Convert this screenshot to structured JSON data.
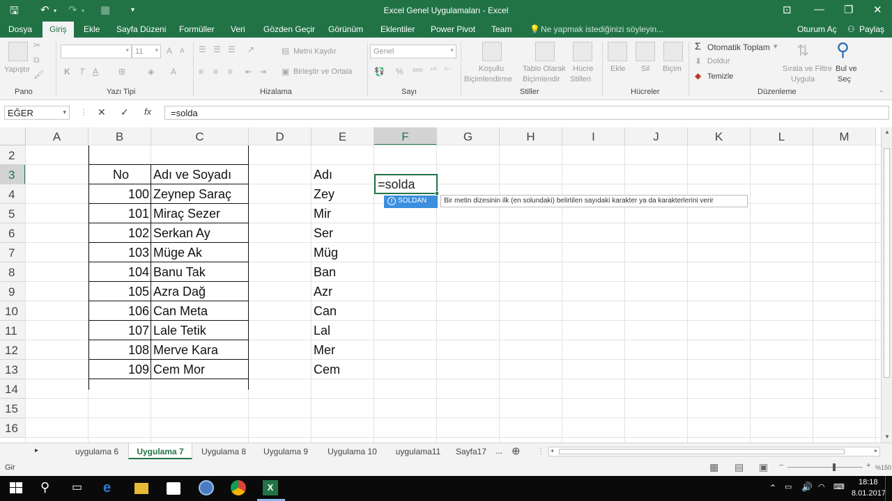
{
  "window": {
    "title": "Excel Genel Uygulamaları - Excel"
  },
  "menu": {
    "file": "Dosya",
    "home": "Giriş",
    "insert": "Ekle",
    "layout": "Sayfa Düzeni",
    "formulas": "Formüller",
    "data": "Veri",
    "review": "Gözden Geçir",
    "view": "Görünüm",
    "addins": "Eklentiler",
    "powerpivot": "Power Pivot",
    "team": "Team",
    "tellme": "Ne yapmak istediğinizi söyleyin...",
    "signin": "Oturum Aç",
    "share": "Paylaş"
  },
  "ribbon": {
    "paste": "Yapıştır",
    "clipboard": "Pano",
    "font_size": "11",
    "font_group": "Yazı Tipi",
    "bold": "K",
    "italic": "T",
    "underline": "A",
    "wrap_text": "Metni Kaydır",
    "merge": "Birleştir ve Ortala",
    "alignment": "Hizalama",
    "number_format": "Genel",
    "percent": "%",
    "number": "Sayı",
    "cond_fmt_1": "Koşullu",
    "cond_fmt_2": "Biçimlendirme",
    "table_fmt_1": "Tablo Olarak",
    "table_fmt_2": "Biçimlendir",
    "cell_styles_1": "Hücre",
    "cell_styles_2": "Stilleri",
    "styles": "Stiller",
    "insert": "Ekle",
    "delete": "Sil",
    "format": "Biçim",
    "cells": "Hücreler",
    "autosum": "Otomatik Toplam",
    "fill": "Doldur",
    "clear": "Temizle",
    "sort_1": "Sırala ve Filtre",
    "sort_2": "Uygula",
    "find_1": "Bul ve",
    "find_2": "Seç",
    "editing": "Düzenleme"
  },
  "formula_bar": {
    "name_box": "EĞER",
    "cancel": "✕",
    "enter": "✓",
    "fx": "fx",
    "formula": "=solda"
  },
  "columns": [
    "A",
    "B",
    "C",
    "D",
    "E",
    "F",
    "G",
    "H",
    "I",
    "J",
    "K",
    "L",
    "M"
  ],
  "rows": [
    "2",
    "3",
    "4",
    "5",
    "6",
    "7",
    "8",
    "9",
    "10",
    "11",
    "12",
    "13",
    "14",
    "15",
    "16"
  ],
  "table": {
    "header_no": "No",
    "header_name": "Adı ve Soyadı",
    "header_first": "Adı",
    "records": [
      {
        "no": "100",
        "name": "Zeynep Saraç",
        "first": "Zey"
      },
      {
        "no": "101",
        "name": "Miraç Sezer",
        "first": "Mir"
      },
      {
        "no": "102",
        "name": "Serkan Ay",
        "first": "Ser"
      },
      {
        "no": "103",
        "name": "Müge Ak",
        "first": "Müg"
      },
      {
        "no": "104",
        "name": "Banu Tak",
        "first": "Ban"
      },
      {
        "no": "105",
        "name": "Azra Dağ",
        "first": "Azr"
      },
      {
        "no": "106",
        "name": "Can Meta",
        "first": "Can"
      },
      {
        "no": "107",
        "name": "Lale Tetik",
        "first": "Lal"
      },
      {
        "no": "108",
        "name": "Merve Kara",
        "first": "Mer"
      },
      {
        "no": "109",
        "name": "Cem Mor",
        "first": "Cem"
      }
    ]
  },
  "active_cell": {
    "value": "=solda"
  },
  "autocomplete": {
    "item": "SOLDAN",
    "tooltip": "Bir metin dizesinin ilk (en solundaki) belirtilen sayıdaki karakter ya da karakterlerini verir"
  },
  "sheets": [
    "uygulama 6",
    "Uygulama 7",
    "Uygulama 8",
    "Uygulama 9",
    "Uygulama 10",
    "uygulama11",
    "Sayfa17"
  ],
  "sheets_more": "...",
  "status": {
    "mode": "Gir",
    "zoom": "%150"
  },
  "taskbar": {
    "time": "18:18",
    "date": "8.01.2017"
  },
  "colors": {
    "excel_green": "#217346",
    "autocomplete_blue": "#3c8fde"
  }
}
